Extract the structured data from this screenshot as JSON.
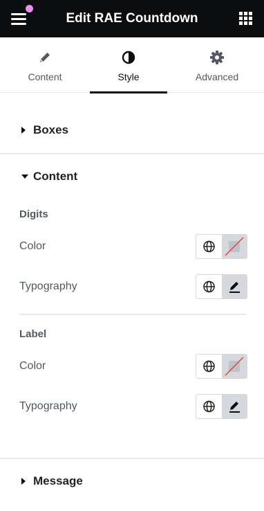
{
  "header": {
    "title": "Edit RAE Countdown",
    "menu_icon": "hamburger-icon",
    "apps_icon": "grid-icon",
    "notification_color": "#e98ff0"
  },
  "tabs": [
    {
      "label": "Content",
      "icon": "pencil-icon",
      "active": false
    },
    {
      "label": "Style",
      "icon": "contrast-icon",
      "active": true
    },
    {
      "label": "Advanced",
      "icon": "gear-icon",
      "active": false
    }
  ],
  "sections": {
    "boxes": {
      "title": "Boxes",
      "expanded": false
    },
    "content": {
      "title": "Content",
      "expanded": true,
      "digits": {
        "heading": "Digits",
        "color_label": "Color",
        "typography_label": "Typography"
      },
      "label": {
        "heading": "Label",
        "color_label": "Color",
        "typography_label": "Typography"
      }
    },
    "message": {
      "title": "Message",
      "expanded": false
    }
  },
  "colors": {
    "topbar": "#0c0d0e",
    "accent_slash": "#e04545"
  }
}
